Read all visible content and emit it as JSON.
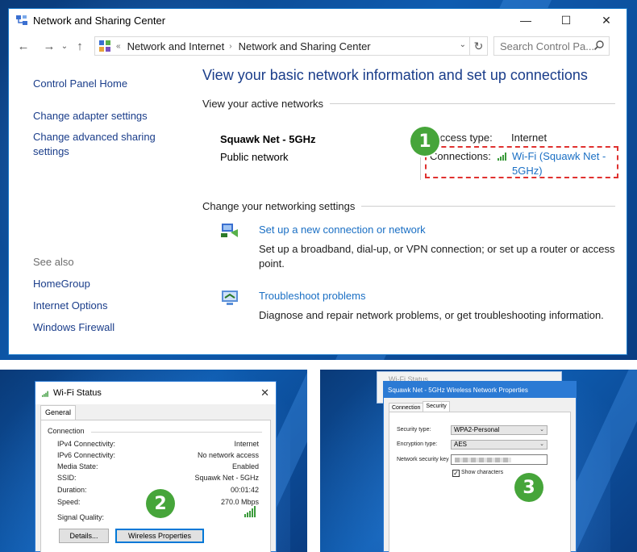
{
  "main_window": {
    "title": "Network and Sharing Center",
    "controls": {
      "minimize": "—",
      "maximize": "☐",
      "close": "✕"
    },
    "address": {
      "crumbs": [
        "Network and Internet",
        "Network and Sharing Center"
      ],
      "overflow": "«",
      "separator": "›"
    },
    "search_placeholder": "Search Control Pa...",
    "sidebar": {
      "home": "Control Panel Home",
      "links": [
        "Change adapter settings",
        "Change advanced sharing settings"
      ],
      "see_also_label": "See also",
      "see_also": [
        "HomeGroup",
        "Internet Options",
        "Windows Firewall"
      ]
    },
    "heading": "View your basic network information and set up connections",
    "active_networks_label": "View your active networks",
    "network": {
      "name": "Squawk Net - 5GHz",
      "type": "Public network",
      "access_type_label": "Access type:",
      "access_type_value": "Internet",
      "connections_label": "Connections:",
      "connection_link_line1": "Wi-Fi (Squawk Net -",
      "connection_link_line2": "5GHz)"
    },
    "change_settings_label": "Change your networking settings",
    "tasks": [
      {
        "link": "Set up a new connection or network",
        "desc_line1": "Set up a broadband, dial-up, or VPN connection; or set up a router or access",
        "desc_line2": "point."
      },
      {
        "link": "Troubleshoot problems",
        "desc_line1": "Diagnose and repair network problems, or get troubleshooting information."
      }
    ],
    "step_badge": "1",
    "accent_color": "#1a6fc4",
    "highlight_color": "#e0312f"
  },
  "wifi_status": {
    "title": "Wi-Fi Status",
    "tab": "General",
    "group": "Connection",
    "rows": [
      {
        "label": "IPv4 Connectivity:",
        "value": "Internet"
      },
      {
        "label": "IPv6 Connectivity:",
        "value": "No network access"
      },
      {
        "label": "Media State:",
        "value": "Enabled"
      },
      {
        "label": "SSID:",
        "value": "Squawk Net - 5GHz"
      },
      {
        "label": "Duration:",
        "value": "00:01:42"
      },
      {
        "label": "Speed:",
        "value": "270.0 Mbps"
      }
    ],
    "signal_label": "Signal Quality:",
    "buttons": {
      "details": "Details...",
      "wireless": "Wireless Properties"
    },
    "step_badge": "2"
  },
  "net_properties": {
    "background_title": "Wi-Fi Status",
    "title": "Squawk Net - 5GHz Wireless Network Properties",
    "tabs": [
      "Connection",
      "Security"
    ],
    "fields": {
      "security_type_label": "Security type:",
      "security_type_value": "WPA2-Personal",
      "encryption_label": "Encryption type:",
      "encryption_value": "AES",
      "key_label": "Network security key"
    },
    "show_characters": "Show characters",
    "show_characters_checked": true,
    "step_badge": "3"
  },
  "badge_color": "#46a53a"
}
